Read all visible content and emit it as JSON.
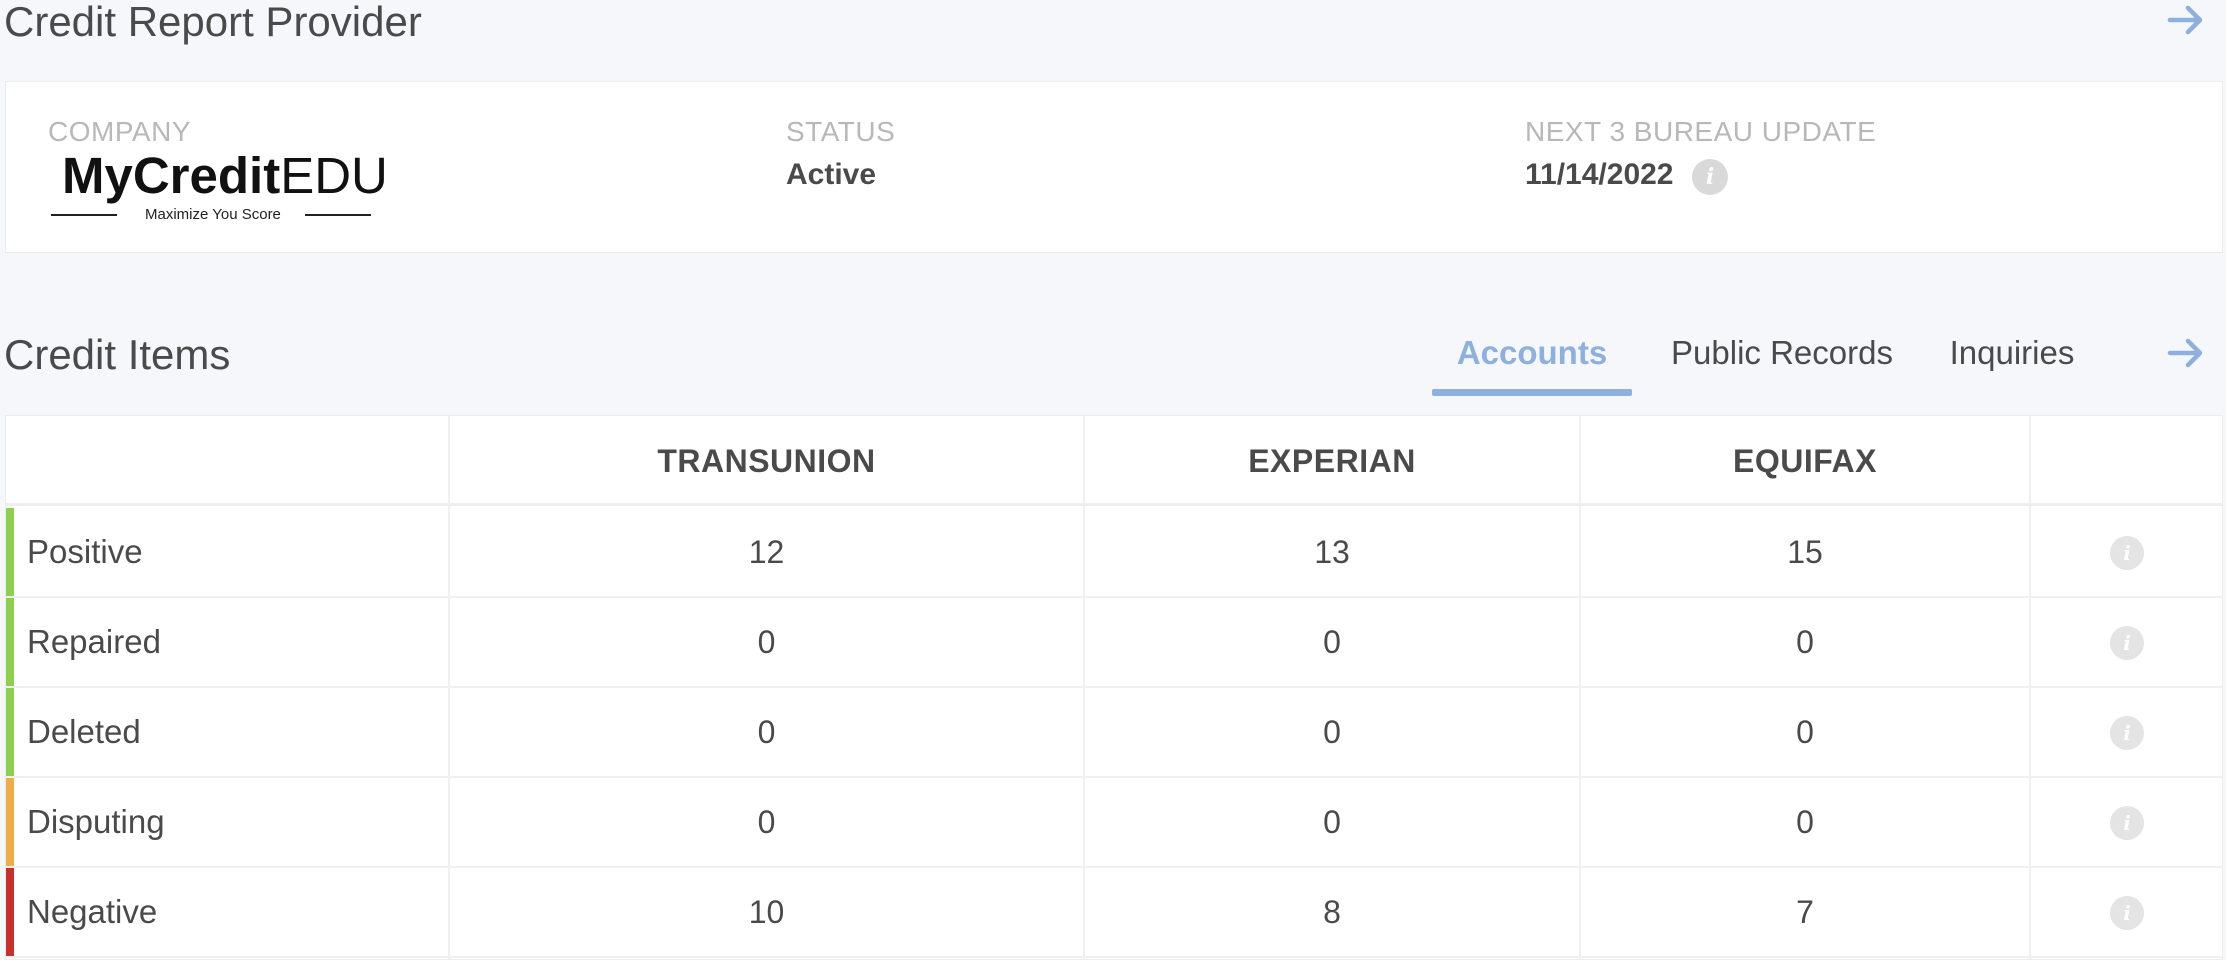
{
  "provider_section": {
    "title": "Credit Report Provider",
    "company_label": "COMPANY",
    "logo": {
      "brand_bold": "MyCredit",
      "brand_light": "EDU",
      "tagline": "Maximize You Score"
    },
    "status_label": "STATUS",
    "status_value": "Active",
    "next_update_label": "NEXT 3 BUREAU UPDATE",
    "next_update_value": "11/14/2022",
    "info_icon": "i"
  },
  "credit_items": {
    "title": "Credit Items",
    "tabs": [
      {
        "label": "Accounts",
        "active": true
      },
      {
        "label": "Public Records",
        "active": false
      },
      {
        "label": "Inquiries",
        "active": false
      }
    ],
    "columns": [
      "TRANSUNION",
      "EXPERIAN",
      "EQUIFAX"
    ],
    "rows": [
      {
        "label": "Positive",
        "color": "#8dcf4f",
        "values": [
          "12",
          "13",
          "15"
        ],
        "info": "i"
      },
      {
        "label": "Repaired",
        "color": "#8dcf4f",
        "values": [
          "0",
          "0",
          "0"
        ],
        "info": "i"
      },
      {
        "label": "Deleted",
        "color": "#8dcf4f",
        "values": [
          "0",
          "0",
          "0"
        ],
        "info": "i"
      },
      {
        "label": "Disputing",
        "color": "#efad4a",
        "values": [
          "0",
          "0",
          "0"
        ],
        "info": "i"
      },
      {
        "label": "Negative",
        "color": "#c9302c",
        "values": [
          "10",
          "8",
          "7"
        ],
        "info": "i"
      }
    ]
  },
  "colors": {
    "accent": "#8eb0de",
    "arrow": "#8eb0de"
  },
  "icons": {
    "nav_arrow": "arrow-right-icon",
    "info": "info-icon"
  }
}
